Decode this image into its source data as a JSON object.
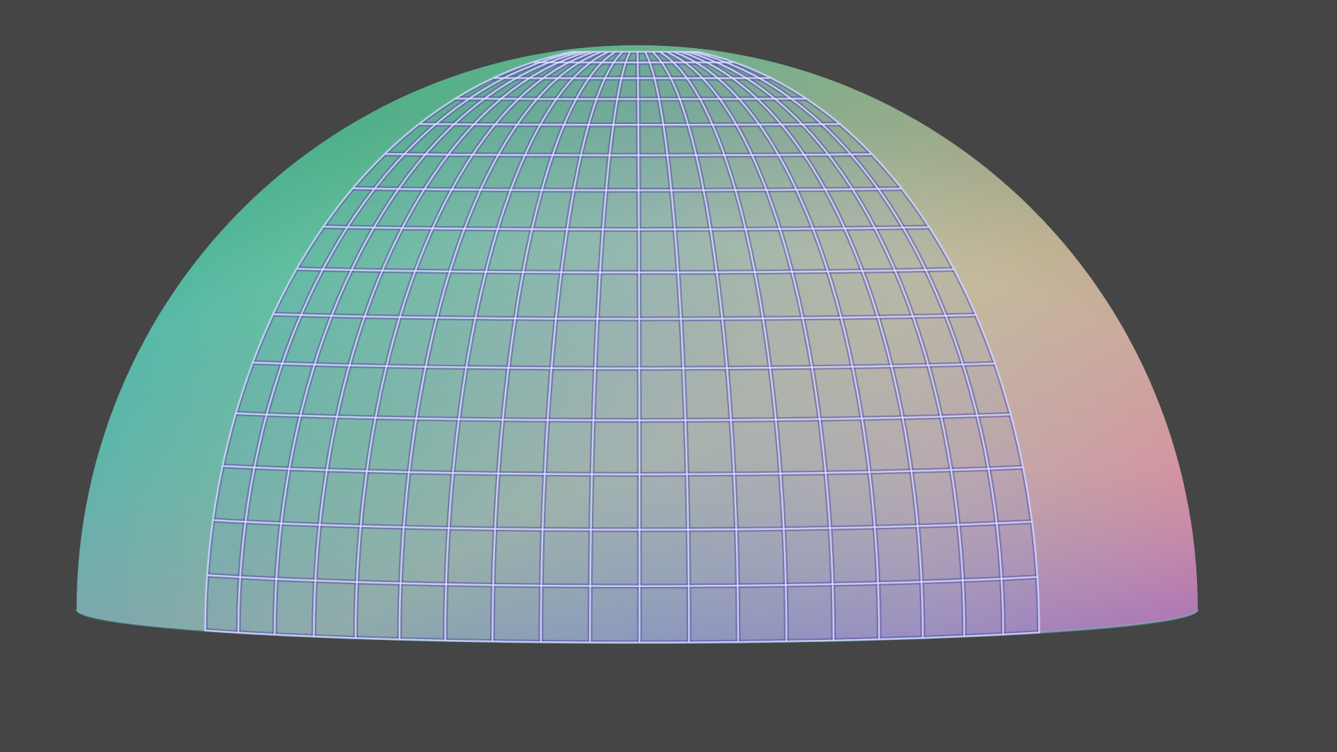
{
  "viewport": {
    "background_color": "#454545"
  },
  "dome": {
    "shading": "normal-map",
    "colors": {
      "left": "#1ea7a0",
      "top_left": "#2fc58c",
      "top_right": "#b8c08a",
      "right": "#e0849c",
      "bottom_left": "#2a7bc0",
      "bottom_center": "#6a6ed0",
      "bottom_right": "#c070d0",
      "groove_light": "#dbe6ff",
      "groove_dark": "#5c4ea8"
    },
    "grid": {
      "columns": 19,
      "rows": 15
    }
  }
}
